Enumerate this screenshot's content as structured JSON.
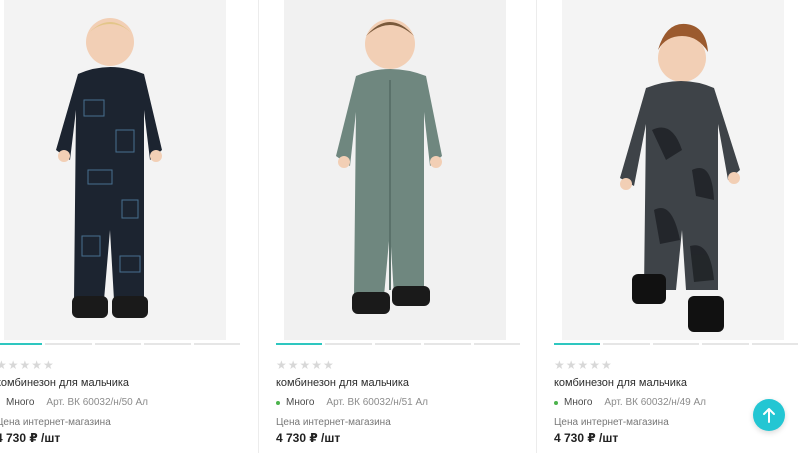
{
  "products": [
    {
      "rating": "★★★★★",
      "title": "комбинезон для мальчика",
      "availability": "Много",
      "sku": "Арт. ВК 60032/н/50 Ал",
      "price_label": "Цена интернет-магазина",
      "price": "4 730 ₽ /шт",
      "suit_color": "#1c2430",
      "image_position": 1,
      "image_count": 5
    },
    {
      "rating": "★★★★★",
      "title": "комбинезон для мальчика",
      "availability": "Много",
      "sku": "Арт. ВК 60032/н/51 Ал",
      "price_label": "Цена интернет-магазина",
      "price": "4 730 ₽ /шт",
      "suit_color": "#6f877f",
      "image_position": 1,
      "image_count": 5
    },
    {
      "rating": "★★★★★",
      "title": "комбинезон для мальчика",
      "availability": "Много",
      "sku": "Арт. ВК 60032/н/49 Ал",
      "price_label": "Цена интернет-магазина",
      "price": "4 730 ₽ /шт",
      "suit_color": "#3e4348",
      "image_position": 1,
      "image_count": 5
    }
  ],
  "colors": {
    "accent": "#2ec7c0",
    "scroll_button": "#23c6d3",
    "in_stock": "#4cb34c"
  },
  "icons": {
    "scroll_top": "arrow-up-icon",
    "rating": "star-icon"
  }
}
